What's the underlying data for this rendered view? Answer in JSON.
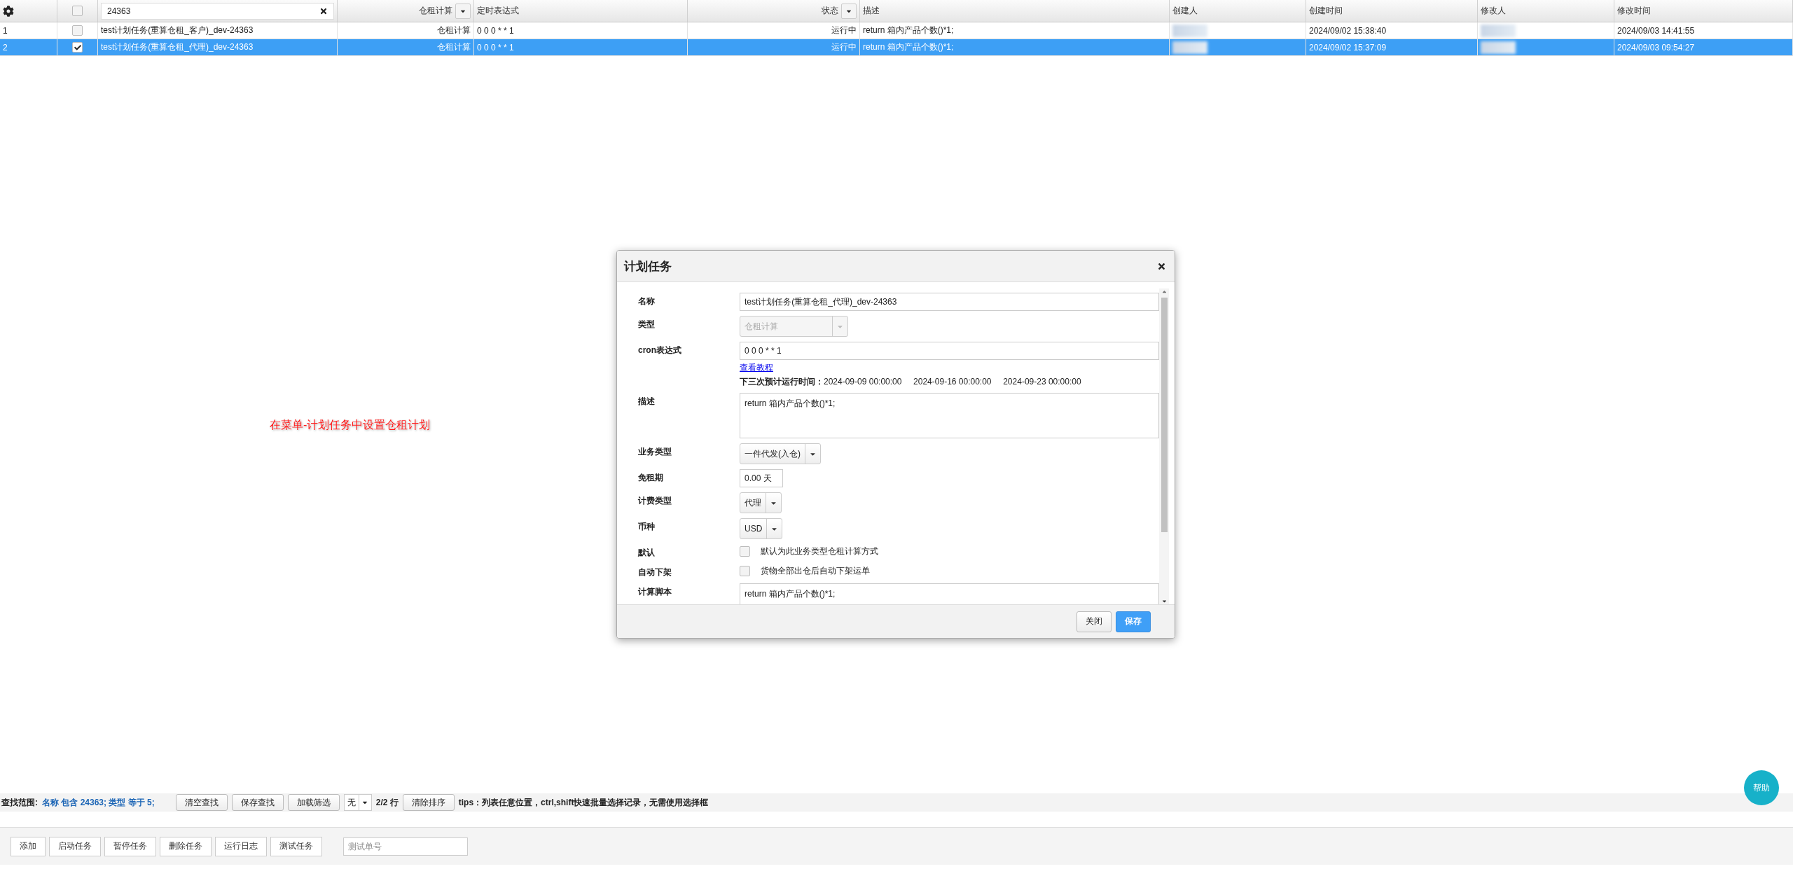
{
  "table": {
    "columns": [
      {
        "kind": "settings"
      },
      {
        "kind": "select_all",
        "checked": false
      },
      {
        "kind": "filter",
        "value": "24363"
      },
      {
        "kind": "dropdown",
        "label": "仓租计算"
      },
      {
        "kind": "label",
        "label": "定时表达式"
      },
      {
        "kind": "dropdown",
        "label": "状态"
      },
      {
        "kind": "label",
        "label": "描述"
      },
      {
        "kind": "label",
        "label": "创建人"
      },
      {
        "kind": "label",
        "label": "创建时间"
      },
      {
        "kind": "label",
        "label": "修改人"
      },
      {
        "kind": "label",
        "label": "修改时间"
      }
    ],
    "rows": [
      {
        "index": "1",
        "checked": false,
        "selected": false,
        "name": "test计划任务(重算仓租_客户)_dev-24363",
        "type": "仓租计算",
        "cron": "0 0 0 * * 1",
        "status": "运行中",
        "description": "return 箱内产品个数()*1;",
        "created": "2024/09/02 15:38:40",
        "modified": "2024/09/03 14:41:55"
      },
      {
        "index": "2",
        "checked": true,
        "selected": true,
        "name": "test计划任务(重算仓租_代理)_dev-24363",
        "type": "仓租计算",
        "cron": "0 0 0 * * 1",
        "status": "运行中",
        "description": "return 箱内产品个数()*1;",
        "created": "2024/09/02 15:37:09",
        "modified": "2024/09/03 09:54:27"
      }
    ]
  },
  "annotation": "在菜单-计划任务中设置仓租计划",
  "dialog": {
    "title": "计划任务",
    "fields": [
      {
        "kind": "text",
        "label": "名称",
        "value": "test计划任务(重算仓租_代理)_dev-24363"
      },
      {
        "kind": "select",
        "label": "类型",
        "value": "仓租计算",
        "disabled": true
      },
      {
        "kind": "cron",
        "label": "cron表达式",
        "value": "0 0 0 * * 1",
        "link": "查看教程",
        "next_label": "下三次预计运行时间：",
        "next_runs": [
          "2024-09-09 00:00:00",
          "2024-09-16 00:00:00",
          "2024-09-23 00:00:00"
        ]
      },
      {
        "kind": "textarea",
        "label": "描述",
        "value": "return 箱内产品个数()*1;"
      },
      {
        "kind": "select",
        "label": "业务类型",
        "value": "一件代发(入仓)",
        "disabled": false
      },
      {
        "kind": "short",
        "label": "免租期",
        "value": "0.00 天"
      },
      {
        "kind": "select",
        "label": "计费类型",
        "value": "代理",
        "disabled": false
      },
      {
        "kind": "select",
        "label": "币种",
        "value": "USD",
        "disabled": false
      },
      {
        "kind": "checkbox",
        "label": "默认",
        "text": "默认为此业务类型仓租计算方式",
        "checked": false
      },
      {
        "kind": "checkbox",
        "label": "自动下架",
        "text": "货物全部出仓后自动下架运单",
        "checked": false
      },
      {
        "kind": "script",
        "label": "计算脚本",
        "value": "return 箱内产品个数()*1;"
      }
    ],
    "buttons": [
      {
        "kind": "default",
        "label": "关闭"
      },
      {
        "kind": "primary",
        "label": "保存"
      }
    ]
  },
  "filter_bar": {
    "label": "查找范围:",
    "conditions": "名称 包含 24363; 类型 等于 5;",
    "buttons": [
      "清空查找",
      "保存查找",
      "加载筛选"
    ],
    "select": "无",
    "count": "2/2 行",
    "sort_button": "清除排序",
    "tips": "tips：列表任意位置，ctrl,shift快速批量选择记录，无需使用选择框"
  },
  "toolbar": {
    "buttons": [
      "添加",
      "启动任务",
      "暂停任务",
      "删除任务",
      "运行日志",
      "测试任务"
    ],
    "search": {
      "placeholder": "测试单号"
    }
  },
  "help_button": "帮助"
}
